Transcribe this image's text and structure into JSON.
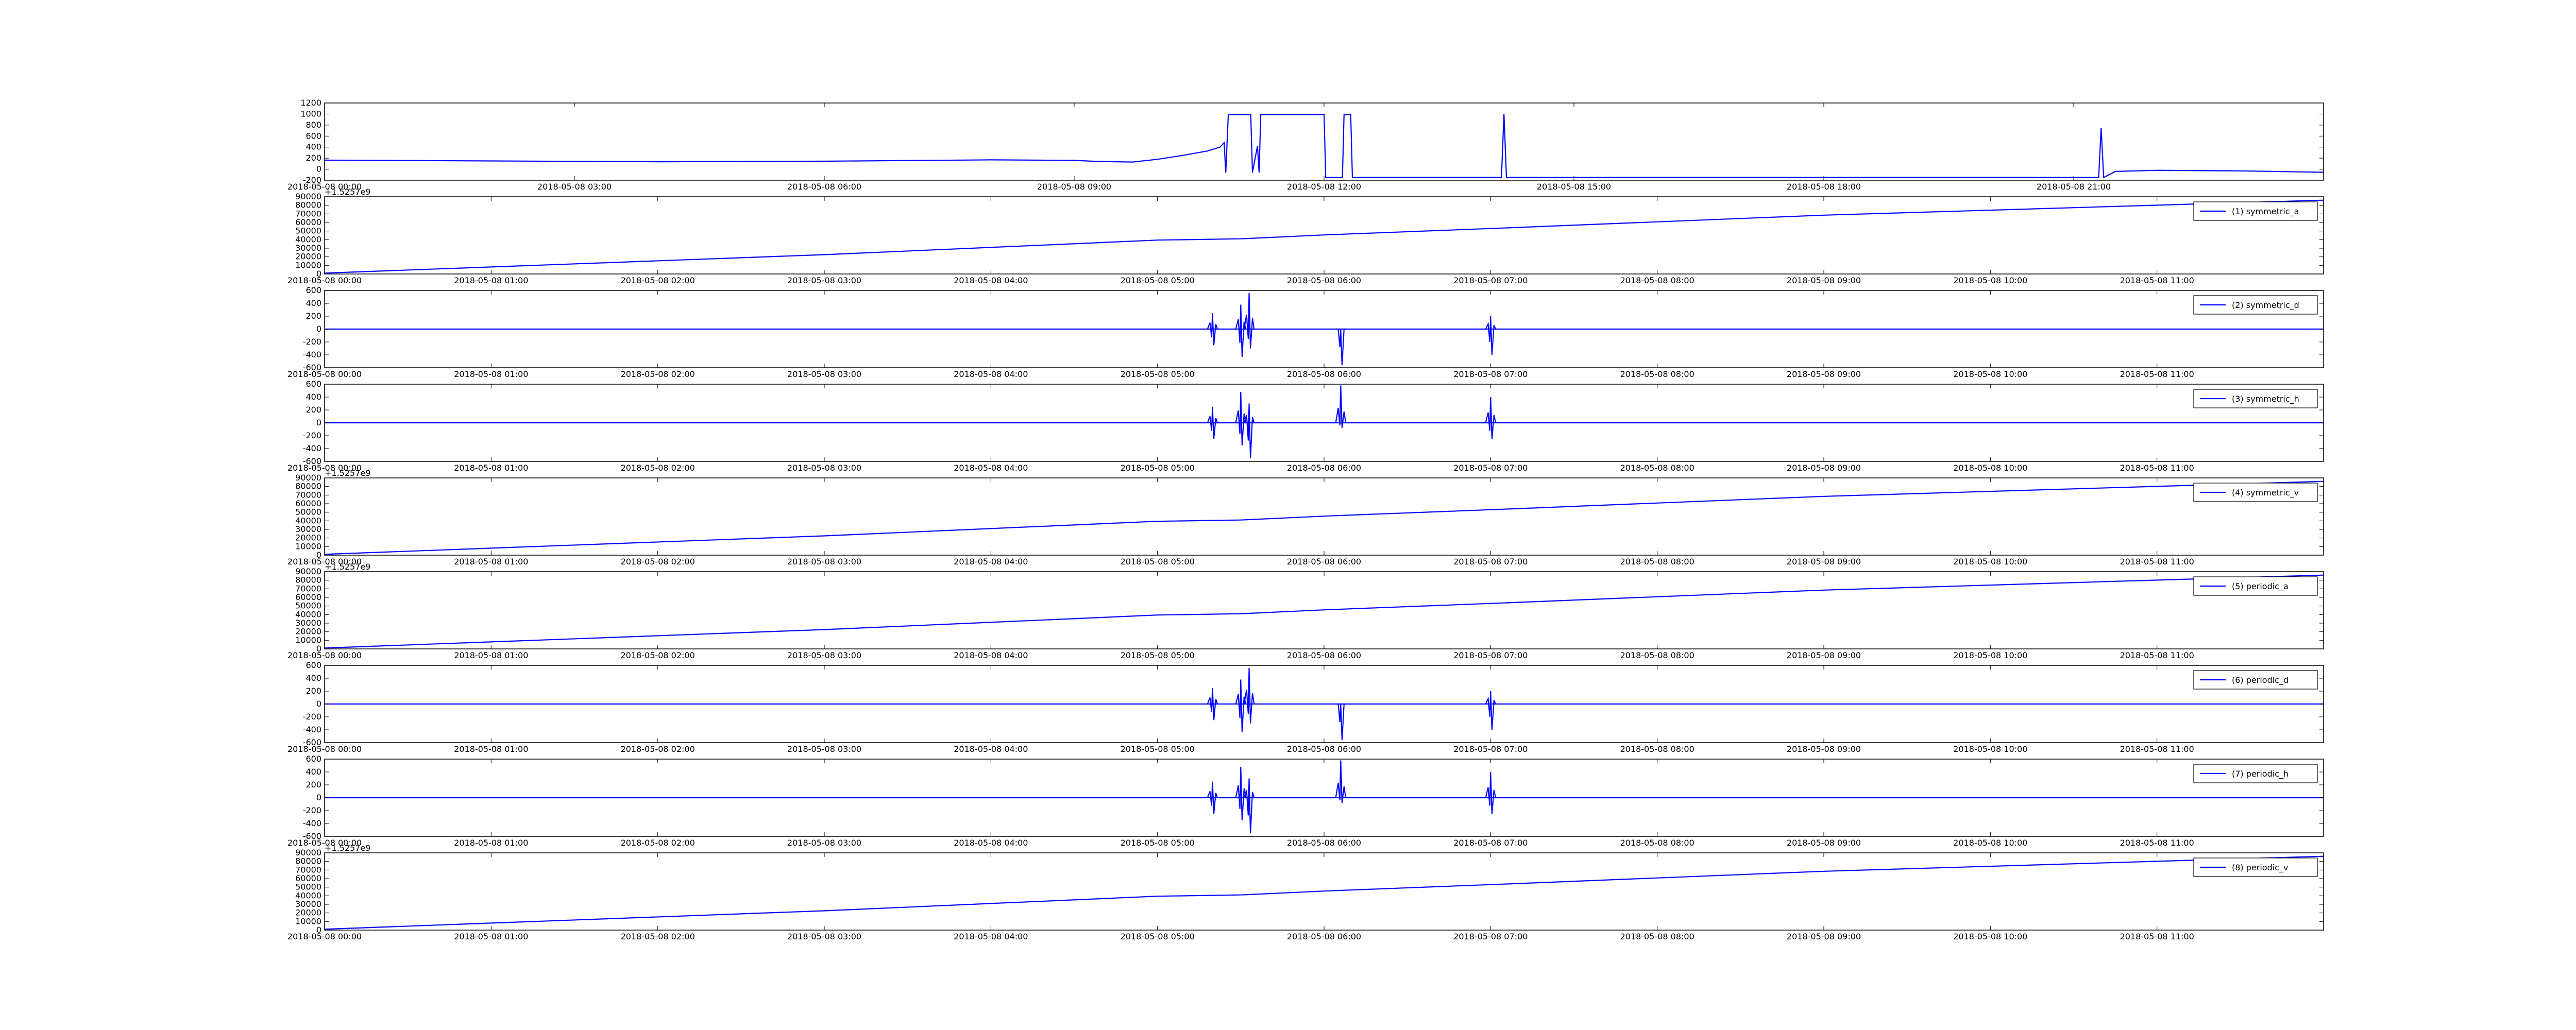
{
  "colors": {
    "line": "#0000ff",
    "frame": "#000000",
    "background": "#ffffff"
  },
  "chart_data": [
    {
      "type": "line",
      "title": "",
      "xlabel": "",
      "ylabel": "",
      "legend": null,
      "x_range": [
        0,
        24
      ],
      "xticks": [
        {
          "v": 0,
          "label": "2018-05-08 00:00"
        },
        {
          "v": 3,
          "label": "2018-05-08 03:00"
        },
        {
          "v": 6,
          "label": "2018-05-08 06:00"
        },
        {
          "v": 9,
          "label": "2018-05-08 09:00"
        },
        {
          "v": 12,
          "label": "2018-05-08 12:00"
        },
        {
          "v": 15,
          "label": "2018-05-08 15:00"
        },
        {
          "v": 18,
          "label": "2018-05-08 18:00"
        },
        {
          "v": 21,
          "label": "2018-05-08 21:00"
        }
      ],
      "ylim": [
        -200,
        1200
      ],
      "yticks": [
        -200,
        0,
        200,
        400,
        600,
        800,
        1000,
        1200
      ],
      "offset_text": "",
      "series": [
        {
          "points": [
            [
              0,
              165
            ],
            [
              2,
              150
            ],
            [
              4,
              135
            ],
            [
              6,
              145
            ],
            [
              8,
              170
            ],
            [
              9,
              160
            ],
            [
              9.3,
              140
            ],
            [
              9.7,
              130
            ],
            [
              10.0,
              180
            ],
            [
              10.3,
              250
            ],
            [
              10.6,
              330
            ],
            [
              10.75,
              400
            ],
            [
              10.8,
              480
            ],
            [
              10.82,
              -60
            ],
            [
              10.85,
              990
            ],
            [
              11.12,
              990
            ],
            [
              11.14,
              -60
            ],
            [
              11.2,
              420
            ],
            [
              11.22,
              -60
            ],
            [
              11.24,
              990
            ],
            [
              12.0,
              990
            ],
            [
              12.02,
              -150
            ],
            [
              12.22,
              -150
            ],
            [
              12.24,
              990
            ],
            [
              12.32,
              990
            ],
            [
              12.34,
              -150
            ],
            [
              14.13,
              -150
            ],
            [
              14.16,
              1000
            ],
            [
              14.19,
              -150
            ],
            [
              21.3,
              -150
            ],
            [
              21.33,
              750
            ],
            [
              21.36,
              -150
            ],
            [
              21.5,
              -40
            ],
            [
              22,
              -20
            ],
            [
              23,
              -30
            ],
            [
              24,
              -55
            ]
          ]
        }
      ],
      "spikes": []
    },
    {
      "type": "line",
      "title": "",
      "xlabel": "",
      "ylabel": "",
      "legend": "(1) symmetric_a",
      "x_range": [
        0,
        12
      ],
      "xticks": [
        {
          "v": 0,
          "label": "2018-05-08 00:00"
        },
        {
          "v": 1,
          "label": "2018-05-08 01:00"
        },
        {
          "v": 2,
          "label": "2018-05-08 02:00"
        },
        {
          "v": 3,
          "label": "2018-05-08 03:00"
        },
        {
          "v": 4,
          "label": "2018-05-08 04:00"
        },
        {
          "v": 5,
          "label": "2018-05-08 05:00"
        },
        {
          "v": 6,
          "label": "2018-05-08 06:00"
        },
        {
          "v": 7,
          "label": "2018-05-08 07:00"
        },
        {
          "v": 8,
          "label": "2018-05-08 08:00"
        },
        {
          "v": 9,
          "label": "2018-05-08 09:00"
        },
        {
          "v": 10,
          "label": "2018-05-08 10:00"
        },
        {
          "v": 11,
          "label": "2018-05-08 11:00"
        }
      ],
      "ylim": [
        0,
        90000
      ],
      "yticks": [
        0,
        10000,
        20000,
        30000,
        40000,
        50000,
        60000,
        70000,
        80000,
        90000
      ],
      "offset_text": "+1.5257e9",
      "series": [
        {
          "points": [
            [
              0,
              1000
            ],
            [
              3,
              22500
            ],
            [
              5,
              39500
            ],
            [
              5.5,
              41000
            ],
            [
              6,
              45500
            ],
            [
              7,
              53000
            ],
            [
              9,
              68500
            ],
            [
              12,
              86000
            ]
          ]
        }
      ],
      "spikes": []
    },
    {
      "type": "line",
      "title": "",
      "xlabel": "",
      "ylabel": "",
      "legend": "(2) symmetric_d",
      "x_range": [
        0,
        12
      ],
      "xticks": [
        {
          "v": 0,
          "label": "2018-05-08 00:00"
        },
        {
          "v": 1,
          "label": "2018-05-08 01:00"
        },
        {
          "v": 2,
          "label": "2018-05-08 02:00"
        },
        {
          "v": 3,
          "label": "2018-05-08 03:00"
        },
        {
          "v": 4,
          "label": "2018-05-08 04:00"
        },
        {
          "v": 5,
          "label": "2018-05-08 05:00"
        },
        {
          "v": 6,
          "label": "2018-05-08 06:00"
        },
        {
          "v": 7,
          "label": "2018-05-08 07:00"
        },
        {
          "v": 8,
          "label": "2018-05-08 08:00"
        },
        {
          "v": 9,
          "label": "2018-05-08 09:00"
        },
        {
          "v": 10,
          "label": "2018-05-08 10:00"
        },
        {
          "v": 11,
          "label": "2018-05-08 11:00"
        }
      ],
      "ylim": [
        -600,
        600
      ],
      "yticks": [
        -600,
        -400,
        -200,
        0,
        200,
        400,
        600
      ],
      "offset_text": "",
      "series": [
        {
          "points": [
            [
              0,
              0
            ],
            [
              12,
              0
            ]
          ]
        }
      ],
      "spikes": [
        [
          5.33,
          250,
          -250
        ],
        [
          5.5,
          380,
          -430
        ],
        [
          5.55,
          560,
          -300
        ],
        [
          6.1,
          0,
          -560
        ],
        [
          7.0,
          200,
          -400
        ]
      ]
    },
    {
      "type": "line",
      "title": "",
      "xlabel": "",
      "ylabel": "",
      "legend": "(3) symmetric_h",
      "x_range": [
        0,
        12
      ],
      "xticks": [
        {
          "v": 0,
          "label": "2018-05-08 00:00"
        },
        {
          "v": 1,
          "label": "2018-05-08 01:00"
        },
        {
          "v": 2,
          "label": "2018-05-08 02:00"
        },
        {
          "v": 3,
          "label": "2018-05-08 03:00"
        },
        {
          "v": 4,
          "label": "2018-05-08 04:00"
        },
        {
          "v": 5,
          "label": "2018-05-08 05:00"
        },
        {
          "v": 6,
          "label": "2018-05-08 06:00"
        },
        {
          "v": 7,
          "label": "2018-05-08 07:00"
        },
        {
          "v": 8,
          "label": "2018-05-08 08:00"
        },
        {
          "v": 9,
          "label": "2018-05-08 09:00"
        },
        {
          "v": 10,
          "label": "2018-05-08 10:00"
        },
        {
          "v": 11,
          "label": "2018-05-08 11:00"
        }
      ],
      "ylim": [
        -600,
        600
      ],
      "yticks": [
        -600,
        -400,
        -200,
        0,
        200,
        400,
        600
      ],
      "offset_text": "",
      "series": [
        {
          "points": [
            [
              0,
              0
            ],
            [
              12,
              0
            ]
          ]
        }
      ],
      "spikes": [
        [
          5.33,
          250,
          -250
        ],
        [
          5.5,
          480,
          -350
        ],
        [
          5.55,
          300,
          -550
        ],
        [
          6.1,
          580,
          -80
        ],
        [
          7.0,
          400,
          -250
        ]
      ]
    },
    {
      "type": "line",
      "title": "",
      "xlabel": "",
      "ylabel": "",
      "legend": "(4) symmetric_v",
      "x_range": [
        0,
        12
      ],
      "xticks": [
        {
          "v": 0,
          "label": "2018-05-08 00:00"
        },
        {
          "v": 1,
          "label": "2018-05-08 01:00"
        },
        {
          "v": 2,
          "label": "2018-05-08 02:00"
        },
        {
          "v": 3,
          "label": "2018-05-08 03:00"
        },
        {
          "v": 4,
          "label": "2018-05-08 04:00"
        },
        {
          "v": 5,
          "label": "2018-05-08 05:00"
        },
        {
          "v": 6,
          "label": "2018-05-08 06:00"
        },
        {
          "v": 7,
          "label": "2018-05-08 07:00"
        },
        {
          "v": 8,
          "label": "2018-05-08 08:00"
        },
        {
          "v": 9,
          "label": "2018-05-08 09:00"
        },
        {
          "v": 10,
          "label": "2018-05-08 10:00"
        },
        {
          "v": 11,
          "label": "2018-05-08 11:00"
        }
      ],
      "ylim": [
        0,
        90000
      ],
      "yticks": [
        0,
        10000,
        20000,
        30000,
        40000,
        50000,
        60000,
        70000,
        80000,
        90000
      ],
      "offset_text": "+1.5257e9",
      "series": [
        {
          "points": [
            [
              0,
              1000
            ],
            [
              3,
              22500
            ],
            [
              5,
              39500
            ],
            [
              5.5,
              41000
            ],
            [
              6,
              45500
            ],
            [
              7,
              53000
            ],
            [
              9,
              68500
            ],
            [
              12,
              86000
            ]
          ]
        }
      ],
      "spikes": []
    },
    {
      "type": "line",
      "title": "",
      "xlabel": "",
      "ylabel": "",
      "legend": "(5) periodic_a",
      "x_range": [
        0,
        12
      ],
      "xticks": [
        {
          "v": 0,
          "label": "2018-05-08 00:00"
        },
        {
          "v": 1,
          "label": "2018-05-08 01:00"
        },
        {
          "v": 2,
          "label": "2018-05-08 02:00"
        },
        {
          "v": 3,
          "label": "2018-05-08 03:00"
        },
        {
          "v": 4,
          "label": "2018-05-08 04:00"
        },
        {
          "v": 5,
          "label": "2018-05-08 05:00"
        },
        {
          "v": 6,
          "label": "2018-05-08 06:00"
        },
        {
          "v": 7,
          "label": "2018-05-08 07:00"
        },
        {
          "v": 8,
          "label": "2018-05-08 08:00"
        },
        {
          "v": 9,
          "label": "2018-05-08 09:00"
        },
        {
          "v": 10,
          "label": "2018-05-08 10:00"
        },
        {
          "v": 11,
          "label": "2018-05-08 11:00"
        }
      ],
      "ylim": [
        0,
        90000
      ],
      "yticks": [
        0,
        10000,
        20000,
        30000,
        40000,
        50000,
        60000,
        70000,
        80000,
        90000
      ],
      "offset_text": "+1.5257e9",
      "series": [
        {
          "points": [
            [
              0,
              1000
            ],
            [
              3,
              22500
            ],
            [
              5,
              39500
            ],
            [
              5.5,
              41000
            ],
            [
              6,
              45500
            ],
            [
              7,
              53000
            ],
            [
              9,
              68500
            ],
            [
              12,
              86000
            ]
          ]
        }
      ],
      "spikes": []
    },
    {
      "type": "line",
      "title": "",
      "xlabel": "",
      "ylabel": "",
      "legend": "(6) periodic_d",
      "x_range": [
        0,
        12
      ],
      "xticks": [
        {
          "v": 0,
          "label": "2018-05-08 00:00"
        },
        {
          "v": 1,
          "label": "2018-05-08 01:00"
        },
        {
          "v": 2,
          "label": "2018-05-08 02:00"
        },
        {
          "v": 3,
          "label": "2018-05-08 03:00"
        },
        {
          "v": 4,
          "label": "2018-05-08 04:00"
        },
        {
          "v": 5,
          "label": "2018-05-08 05:00"
        },
        {
          "v": 6,
          "label": "2018-05-08 06:00"
        },
        {
          "v": 7,
          "label": "2018-05-08 07:00"
        },
        {
          "v": 8,
          "label": "2018-05-08 08:00"
        },
        {
          "v": 9,
          "label": "2018-05-08 09:00"
        },
        {
          "v": 10,
          "label": "2018-05-08 10:00"
        },
        {
          "v": 11,
          "label": "2018-05-08 11:00"
        }
      ],
      "ylim": [
        -600,
        600
      ],
      "yticks": [
        -600,
        -400,
        -200,
        0,
        200,
        400,
        600
      ],
      "offset_text": "",
      "series": [
        {
          "points": [
            [
              0,
              0
            ],
            [
              12,
              0
            ]
          ]
        }
      ],
      "spikes": [
        [
          5.33,
          250,
          -250
        ],
        [
          5.5,
          380,
          -430
        ],
        [
          5.55,
          560,
          -300
        ],
        [
          6.1,
          0,
          -560
        ],
        [
          7.0,
          200,
          -400
        ]
      ]
    },
    {
      "type": "line",
      "title": "",
      "xlabel": "",
      "ylabel": "",
      "legend": "(7) periodic_h",
      "x_range": [
        0,
        12
      ],
      "xticks": [
        {
          "v": 0,
          "label": "2018-05-08 00:00"
        },
        {
          "v": 1,
          "label": "2018-05-08 01:00"
        },
        {
          "v": 2,
          "label": "2018-05-08 02:00"
        },
        {
          "v": 3,
          "label": "2018-05-08 03:00"
        },
        {
          "v": 4,
          "label": "2018-05-08 04:00"
        },
        {
          "v": 5,
          "label": "2018-05-08 05:00"
        },
        {
          "v": 6,
          "label": "2018-05-08 06:00"
        },
        {
          "v": 7,
          "label": "2018-05-08 07:00"
        },
        {
          "v": 8,
          "label": "2018-05-08 08:00"
        },
        {
          "v": 9,
          "label": "2018-05-08 09:00"
        },
        {
          "v": 10,
          "label": "2018-05-08 10:00"
        },
        {
          "v": 11,
          "label": "2018-05-08 11:00"
        }
      ],
      "ylim": [
        -600,
        600
      ],
      "yticks": [
        -600,
        -400,
        -200,
        0,
        200,
        400,
        600
      ],
      "offset_text": "",
      "series": [
        {
          "points": [
            [
              0,
              0
            ],
            [
              12,
              0
            ]
          ]
        }
      ],
      "spikes": [
        [
          5.33,
          250,
          -250
        ],
        [
          5.5,
          480,
          -350
        ],
        [
          5.55,
          300,
          -550
        ],
        [
          6.1,
          580,
          -80
        ],
        [
          7.0,
          400,
          -250
        ]
      ]
    },
    {
      "type": "line",
      "title": "",
      "xlabel": "",
      "ylabel": "",
      "legend": "(8) periodic_v",
      "x_range": [
        0,
        12
      ],
      "xticks": [
        {
          "v": 0,
          "label": "2018-05-08 00:00"
        },
        {
          "v": 1,
          "label": "2018-05-08 01:00"
        },
        {
          "v": 2,
          "label": "2018-05-08 02:00"
        },
        {
          "v": 3,
          "label": "2018-05-08 03:00"
        },
        {
          "v": 4,
          "label": "2018-05-08 04:00"
        },
        {
          "v": 5,
          "label": "2018-05-08 05:00"
        },
        {
          "v": 6,
          "label": "2018-05-08 06:00"
        },
        {
          "v": 7,
          "label": "2018-05-08 07:00"
        },
        {
          "v": 8,
          "label": "2018-05-08 08:00"
        },
        {
          "v": 9,
          "label": "2018-05-08 09:00"
        },
        {
          "v": 10,
          "label": "2018-05-08 10:00"
        },
        {
          "v": 11,
          "label": "2018-05-08 11:00"
        }
      ],
      "ylim": [
        0,
        90000
      ],
      "yticks": [
        0,
        10000,
        20000,
        30000,
        40000,
        50000,
        60000,
        70000,
        80000,
        90000
      ],
      "offset_text": "+1.5257e9",
      "series": [
        {
          "points": [
            [
              0,
              1000
            ],
            [
              3,
              22500
            ],
            [
              5,
              39500
            ],
            [
              5.5,
              41000
            ],
            [
              6,
              45500
            ],
            [
              7,
              53000
            ],
            [
              9,
              68500
            ],
            [
              12,
              86000
            ]
          ]
        }
      ],
      "spikes": []
    }
  ]
}
